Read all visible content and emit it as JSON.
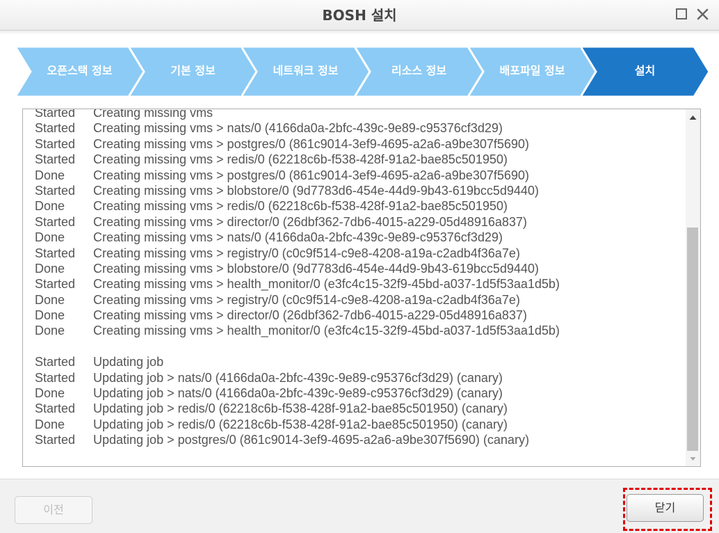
{
  "window": {
    "title": "BOSH 설치",
    "maximize_icon": "maximize-icon",
    "close_icon": "close-icon"
  },
  "wizard": {
    "steps": [
      {
        "label": "오픈스택 정보",
        "state": "completed"
      },
      {
        "label": "기본 정보",
        "state": "completed"
      },
      {
        "label": "네트워크 정보",
        "state": "completed"
      },
      {
        "label": "리소스 정보",
        "state": "completed"
      },
      {
        "label": "배포파일 정보",
        "state": "completed"
      },
      {
        "label": "설치",
        "state": "active"
      }
    ],
    "colors": {
      "completed": "#8ccbf5",
      "active": "#1e78c8"
    }
  },
  "log": {
    "lines": [
      {
        "status": "Started",
        "message": "Creating missing vms"
      },
      {
        "status": "Started",
        "message": "Creating missing vms > nats/0 (4166da0a-2bfc-439c-9e89-c95376cf3d29)"
      },
      {
        "status": "Started",
        "message": "Creating missing vms > postgres/0 (861c9014-3ef9-4695-a2a6-a9be307f5690)"
      },
      {
        "status": "Started",
        "message": "Creating missing vms > redis/0 (62218c6b-f538-428f-91a2-bae85c501950)"
      },
      {
        "status": "Done",
        "message": "Creating missing vms > postgres/0 (861c9014-3ef9-4695-a2a6-a9be307f5690)"
      },
      {
        "status": "Started",
        "message": "Creating missing vms > blobstore/0 (9d7783d6-454e-44d9-9b43-619bcc5d9440)"
      },
      {
        "status": "Done",
        "message": "Creating missing vms > redis/0 (62218c6b-f538-428f-91a2-bae85c501950)"
      },
      {
        "status": "Started",
        "message": "Creating missing vms > director/0 (26dbf362-7db6-4015-a229-05d48916a837)"
      },
      {
        "status": "Done",
        "message": "Creating missing vms > nats/0 (4166da0a-2bfc-439c-9e89-c95376cf3d29)"
      },
      {
        "status": "Started",
        "message": "Creating missing vms > registry/0 (c0c9f514-c9e8-4208-a19a-c2adb4f36a7e)"
      },
      {
        "status": "Done",
        "message": "Creating missing vms > blobstore/0 (9d7783d6-454e-44d9-9b43-619bcc5d9440)"
      },
      {
        "status": "Started",
        "message": "Creating missing vms > health_monitor/0 (e3fc4c15-32f9-45bd-a037-1d5f53aa1d5b)"
      },
      {
        "status": "Done",
        "message": "Creating missing vms > registry/0 (c0c9f514-c9e8-4208-a19a-c2adb4f36a7e)"
      },
      {
        "status": "Done",
        "message": "Creating missing vms > director/0 (26dbf362-7db6-4015-a229-05d48916a837)"
      },
      {
        "status": "Done",
        "message": "Creating missing vms > health_monitor/0 (e3fc4c15-32f9-45bd-a037-1d5f53aa1d5b)"
      },
      {
        "status": "",
        "message": ""
      },
      {
        "status": "Started",
        "message": "Updating job"
      },
      {
        "status": "Started",
        "message": "Updating job > nats/0 (4166da0a-2bfc-439c-9e89-c95376cf3d29) (canary)"
      },
      {
        "status": "Done",
        "message": "Updating job > nats/0 (4166da0a-2bfc-439c-9e89-c95376cf3d29) (canary)"
      },
      {
        "status": "Started",
        "message": "Updating job > redis/0 (62218c6b-f538-428f-91a2-bae85c501950) (canary)"
      },
      {
        "status": "Done",
        "message": "Updating job > redis/0 (62218c6b-f538-428f-91a2-bae85c501950) (canary)"
      },
      {
        "status": "Started",
        "message": "Updating job > postgres/0 (861c9014-3ef9-4695-a2a6-a9be307f5690) (canary)"
      }
    ],
    "scroll_position": 0.35
  },
  "footer": {
    "prev_label": "이전",
    "close_label": "닫기",
    "highlight_color": "#e00000"
  }
}
